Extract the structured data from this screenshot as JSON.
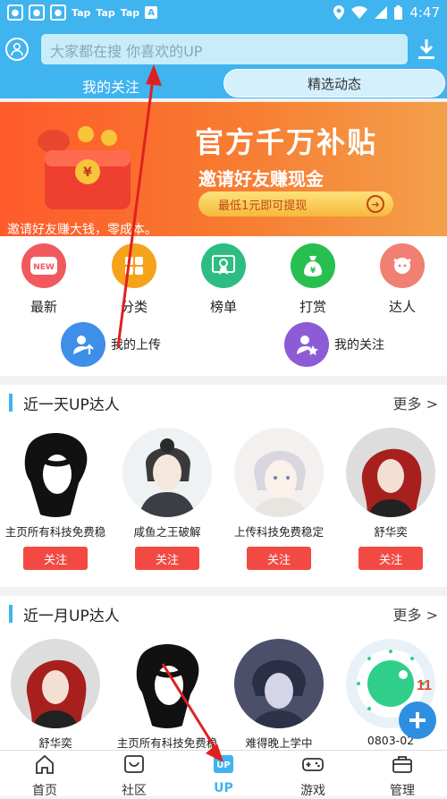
{
  "status_bar": {
    "tap1": "Tap",
    "tap2": "Tap",
    "tap3": "Tap",
    "a_badge": "A",
    "time": "4:47"
  },
  "header": {
    "search_placeholder": "大家都在搜  你喜欢的UP",
    "tabs": [
      {
        "label": "我的关注"
      },
      {
        "label": "精选动态"
      }
    ]
  },
  "banner": {
    "title": "官方千万补贴",
    "subtitle": "邀请好友赚现金",
    "button_label": "最低1元即可提现",
    "caption": "邀请好友赚大钱，零成本。"
  },
  "menu": {
    "items": [
      {
        "label": "最新",
        "badge": "NEW",
        "color": "#f05a5f"
      },
      {
        "label": "分类",
        "color": "#f7a21b"
      },
      {
        "label": "榜单",
        "color": "#2dbd82"
      },
      {
        "label": "打赏",
        "color": "#27c050"
      },
      {
        "label": "达人",
        "color": "#f08073"
      }
    ],
    "row2": [
      {
        "label": "我的上传",
        "color": "#3d8fe8"
      },
      {
        "label": "我的关注",
        "color": "#8e5bd6"
      }
    ]
  },
  "section_day": {
    "title": "近一天UP达人",
    "more": "更多 >",
    "users": [
      {
        "name": "主页所有科技免费稳",
        "follow": "关注"
      },
      {
        "name": "咸鱼之王破解",
        "follow": "关注"
      },
      {
        "name": "上传科技免费稳定",
        "follow": "关注"
      },
      {
        "name": "舒华奕",
        "follow": "关注"
      }
    ]
  },
  "section_month": {
    "title": "近一月UP达人",
    "more": "更多 >",
    "users": [
      {
        "name": "舒华奕"
      },
      {
        "name": "主页所有科技免费稳"
      },
      {
        "name": "难得晚上学中"
      },
      {
        "name": "0803-02"
      }
    ]
  },
  "app_badge_number": "11",
  "bottom_nav": [
    {
      "label": "首页"
    },
    {
      "label": "社区"
    },
    {
      "label": "UP"
    },
    {
      "label": "游戏"
    },
    {
      "label": "管理"
    }
  ],
  "colors": {
    "accent": "#3fb4ee",
    "follow_button": "#f24a43",
    "annotation_arrow": "#e02020"
  }
}
